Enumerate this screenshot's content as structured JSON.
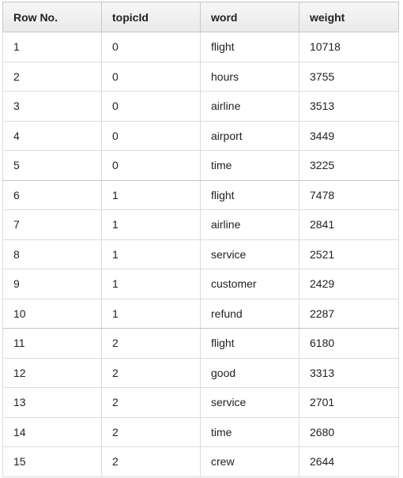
{
  "table": {
    "columns": [
      "Row No.",
      "topicId",
      "word",
      "weight"
    ],
    "rows": [
      [
        "1",
        "0",
        "flight",
        "10718"
      ],
      [
        "2",
        "0",
        "hours",
        "3755"
      ],
      [
        "3",
        "0",
        "airline",
        "3513"
      ],
      [
        "4",
        "0",
        "airport",
        "3449"
      ],
      [
        "5",
        "0",
        "time",
        "3225"
      ],
      [
        "6",
        "1",
        "flight",
        "7478"
      ],
      [
        "7",
        "1",
        "airline",
        "2841"
      ],
      [
        "8",
        "1",
        "service",
        "2521"
      ],
      [
        "9",
        "1",
        "customer",
        "2429"
      ],
      [
        "10",
        "1",
        "refund",
        "2287"
      ],
      [
        "11",
        "2",
        "flight",
        "6180"
      ],
      [
        "12",
        "2",
        "good",
        "3313"
      ],
      [
        "13",
        "2",
        "service",
        "2701"
      ],
      [
        "14",
        "2",
        "time",
        "2680"
      ],
      [
        "15",
        "2",
        "crew",
        "2644"
      ]
    ]
  }
}
